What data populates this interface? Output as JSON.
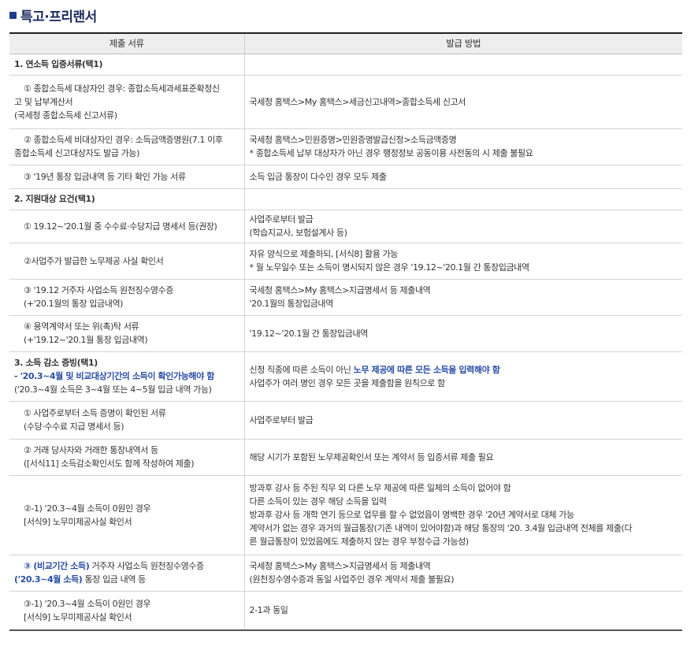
{
  "page": {
    "title": "특고·프리랜서"
  },
  "table": {
    "headers": [
      "제출 서류",
      "발급 방법"
    ],
    "rows": {
      "r1": {
        "c1": [
          "1. 연소득 입증서류(택1)"
        ],
        "c2": []
      },
      "r2": {
        "c1": [
          "① 종합소득세 대상자인 경우: 종합소득세과세표준확정신",
          "고 및 납부계산서",
          "(국세청 종합소득세 신고서류)"
        ],
        "c2": [
          "국세청 홈택스>My 홈택스>세금신고내역>종합소득세 신고서"
        ]
      },
      "r3": {
        "c1": [
          "② 종합소득세 비대상자인 경우: 소득금액증명원(7.1 이후",
          "종합소득세 신고대상자도 발급 가능)"
        ],
        "c2": [
          "국세청 홈택스>민원증명>민원증명발급신청>소득금액증명",
          "* 종합소득세 납부 대상자가 아닌 경우 행정정보 공동이용 사전동의 시 제출 불필요"
        ]
      },
      "r4": {
        "c1": [
          "③ '19년 통장 입금내역 등 기타 확인 가능 서류"
        ],
        "c2": [
          "소득 입금 통장이 다수인 경우 모두 제출"
        ]
      },
      "r5": {
        "c1": [
          "2. 지원대상 요건(택1)"
        ],
        "c2": []
      },
      "r6": {
        "c1": [
          "① 19.12~'20.1월 중 수수료·수당지급 명세서 등(권장)"
        ],
        "c2": [
          "사업주로부터 발급",
          "(학습지교사, 보험설계사 등)"
        ]
      },
      "r7": {
        "c1": [
          "②사업주가 발급한 노무제공 사실 확인서"
        ],
        "c2": [
          "자유 양식으로 제출하되, [서식8] 활용 가능",
          "* 월 노무일수 또는 소득이 명시되지 않은 경우 '19.12~'20.1월 간 통장입금내역"
        ]
      },
      "r8": {
        "c1": [
          "③ '19.12 거주자 사업소득 원천징수영수증",
          "(+'20.1월의 통장 입금내역)"
        ],
        "c2": [
          "국세청 홈택스>My 홈택스>지급명세서 등 제출내역",
          "'20.1월의 통장입금내역"
        ]
      },
      "r9": {
        "c1": [
          "④ 용역계약서 또는 위(촉)탁 서류",
          "(+'19.12~'20.1월 통장 입금내역)"
        ],
        "c2": [
          "'19.12~'20.1월 간 통장입금내역"
        ]
      },
      "r10": {
        "c1": [
          "3. 소득 감소 증빙(택1)",
          "- '20.3~4월 및 비교대상기간의 소득이 확인가능해야 함",
          "('20.3~4월 소득은 3~4월 또는 4~5월 입금 내역 가능)"
        ],
        "c2_a": "신청 직종에 따른 소득이 아닌 ",
        "c2_b": "노무 제공에 따른 모든 소득을 입력해야 함",
        "c2_c": "사업주가 여러 명인 경우 모든 곳을 제출함을 원칙으로 함"
      },
      "r11": {
        "c1": [
          "① 사업주로부터 소득 증명이 확인된 서류",
          "(수당·수수료 지급 명세서 등)"
        ],
        "c2": [
          "사업주로부터 발급"
        ]
      },
      "r12": {
        "c1": [
          "② 거래 당사자와 거래한 통장내역서 등",
          "([서식11] 소득감소확인서도 함께 작성하여 제출)"
        ],
        "c2": [
          "해당 시기가 포함된 노무제공확인서 또는 계약서 등 입증서류 제출 필요"
        ]
      },
      "r13": {
        "c1": [
          "②-1) '20.3~4월 소득이 0원인 경우",
          "[서식9] 노무미제공사실 확인서"
        ],
        "c2": [
          "방과후 강사 등 주된 직무 외 다른 노무 제공에 따른 일체의 소득이 없어야 함",
          "다른 소득이 있는 경우 해당 소득을 입력",
          "방과후 강사 등 개학 연기 등으로 업무를 할 수 없었음이 명백한 경우 '20년 계약서로 대체 가능",
          "계약서가 없는 경우 과거의 월급통장(기존 내역이 있어야함)과 해당 통장의 '20. 3.4월 입금내역 전체를 제출(다",
          "른 월급통장이 있었음에도 제출하지 않는 경우 부정수급 가능성)"
        ]
      },
      "r14": {
        "c1_a": "③ ",
        "c1_b": "(비교기간 소득)",
        "c1_c": " 거주자 사업소득 원천징수영수증",
        "c1_d": "('20.3~4월 소득)",
        "c1_e": " 통장 입금 내역 등",
        "c2": [
          "국세청 홈택스>My 홈택스>지급명세서 등 제출내역",
          "(원천징수영수증과 동일 사업주인 경우 계약서 제출 불필요)"
        ]
      },
      "r15": {
        "c1": [
          "③-1) '20.3~4월 소득이 0원인 경우",
          "[서식9] 노무미제공사실 확인서"
        ],
        "c2": [
          "2-1과 동일"
        ]
      }
    }
  },
  "colors": {
    "title": "#1a2a5e",
    "accent": "#2a4ea5",
    "title_icon": "#1f3b8f"
  }
}
